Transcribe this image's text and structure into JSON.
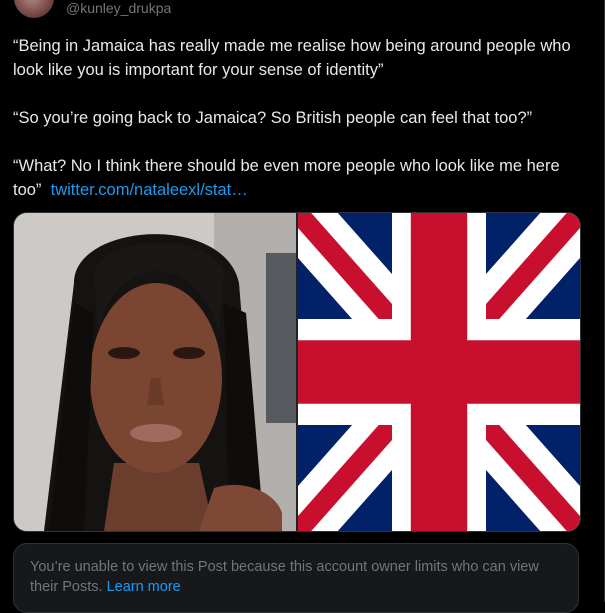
{
  "tweet": {
    "handle": "@kunley_drukpa",
    "paragraphs": [
      "“Being in Jamaica has really made me realise how being around people who look like you is important for your sense of identity”",
      "“So you’re going back to Jamaica? So British people can feel that too?”",
      "“What? No I think there should be even more people who look like me here too”"
    ],
    "link_text": "twitter.com/nataleexl/stat…"
  },
  "notice": {
    "text": "You’re unable to view this Post because this account owner limits who can view their Posts.",
    "link": "Learn more"
  },
  "colors": {
    "background": "#000000",
    "text": "#e7e9ea",
    "secondary": "#71767b",
    "link": "#1d9bf0",
    "flag_blue": "#012169",
    "flag_red": "#c8102e"
  }
}
